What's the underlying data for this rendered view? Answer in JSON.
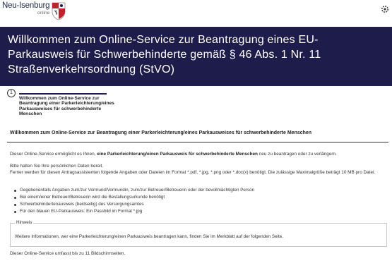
{
  "header": {
    "logo_name": "Neu-Isenburg",
    "logo_sub": "online",
    "settings_icon": "gear-icon"
  },
  "hero": {
    "title": "Willkommen zum Online-Service zur Beantragung eines EU-Parkausweis für Schwerbehinderte gemäß § 46 Abs. 1 Nr. 11 Straßenverkehrsordnung (StVO)"
  },
  "stepper": {
    "step_number": "1",
    "step_label": "Willkommen zum Online-Service zur Beantragung einer Parkerleichterung/eines Parkausweises für schwerbehinderte Menschen"
  },
  "content": {
    "section_title": "Willkommen zum Online-Service zur Beantragung einer Parkerleichterung/eines Parkausweises für schwerbehinderte Menschen",
    "intro_before": "Dieser Online-Service ermöglicht es Ihnen, ",
    "intro_bold": "eine Parkerleichterung/einen Parkausweis für schwerbehinderte Menschen",
    "intro_after": " neu zu beantragen oder zu verlängern.",
    "prepare": "Bitte halten Sie Ihre persönlichen Daten bereit.",
    "required_docs": "Ferner werden für diesen Antragsassistenten folgende Angaben oder Dateien im Format *.pdf, *.jpg, *.png oder *.doc(x) benötigt. Die zulässige Maximalgröße beträgt 10 MB pro Datei.",
    "bullets": [
      "Gegebenenfalls Angaben zum/zur Vormund/Vormundin, zum/zur Betreuer/Betreuerin oder der bevollmächtigten Person",
      "Bei einem/einer Betreuer/Betreuerin wird die Bestallungsurkunde benötigt",
      "Schwerbehindertenausweis (beidseitig) des Versorgungsamtes",
      "Für den blauen EU-Parkausweis: Ein Passbild im Format *.jpg"
    ],
    "note_title": "Hinweis",
    "note_text": "Weitere Informationen, wer eine Parkerleichterung/einen Parkausweis beantragen kann, finden Sie im Merkblatt auf der folgenden Seite.",
    "footer": "Dieser Online-Service umfasst bis zu 11 Bildschirmseiten."
  },
  "colors": {
    "hero_bg": "#1e1c4a",
    "crest_red": "#c4202b"
  }
}
